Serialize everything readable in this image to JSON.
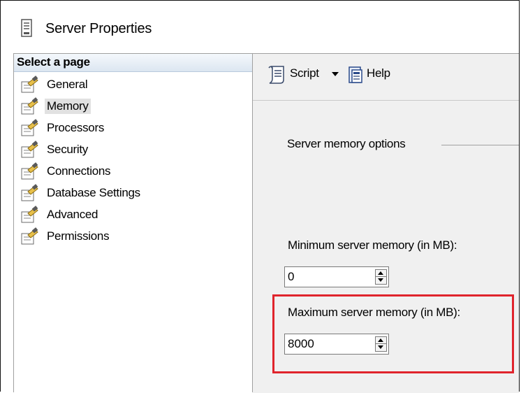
{
  "window": {
    "title": "Server Properties"
  },
  "sidebar": {
    "header": "Select a page",
    "items": [
      {
        "label": "General",
        "selected": false
      },
      {
        "label": "Memory",
        "selected": true
      },
      {
        "label": "Processors",
        "selected": false
      },
      {
        "label": "Security",
        "selected": false
      },
      {
        "label": "Connections",
        "selected": false
      },
      {
        "label": "Database Settings",
        "selected": false
      },
      {
        "label": "Advanced",
        "selected": false
      },
      {
        "label": "Permissions",
        "selected": false
      }
    ]
  },
  "toolbar": {
    "script_label": "Script",
    "help_label": "Help"
  },
  "memory": {
    "group_label": "Server memory options",
    "min_label": "Minimum server memory (in MB):",
    "min_value": "0",
    "max_label": "Maximum server memory (in MB):",
    "max_value": "8000"
  },
  "colors": {
    "highlight": "#e0242c",
    "selected_bg": "#e1e1e1",
    "pane_bg": "#f0f0f0"
  },
  "icons": {
    "title": "server-properties-icon",
    "page": "page-properties-icon",
    "script": "script-icon",
    "help": "help-icon"
  }
}
